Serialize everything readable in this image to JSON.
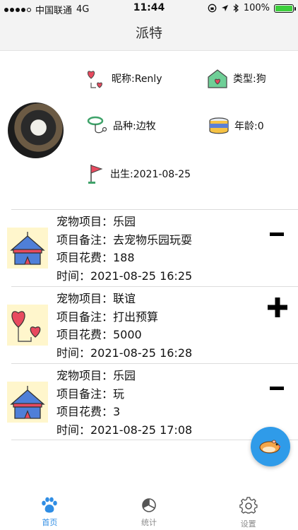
{
  "status_bar": {
    "carrier": "中国联通",
    "network": "4G",
    "time": "11:44",
    "battery": "100%",
    "battery_level": 1.0
  },
  "nav": {
    "title": "派特"
  },
  "profile": {
    "nickname": "昵称:Renly",
    "type": "类型:狗",
    "breed": "品种:边牧",
    "age": "年龄:0",
    "birth": "出生:2021-08-25"
  },
  "records": [
    {
      "project": "宠物项目：乐园",
      "note": "项目备注：去宠物乐园玩耍",
      "cost": "项目花费：188",
      "time": "时间：2021-08-25 16:25",
      "sign": "minus",
      "icon": "tent-icon"
    },
    {
      "project": "宠物项目：联谊",
      "note": "项目备注：打出预算",
      "cost": "项目花费：5000",
      "time": "时间：2021-08-25 16:28",
      "sign": "plus",
      "icon": "heart-balloons-icon"
    },
    {
      "project": "宠物项目：乐园",
      "note": "项目备注：玩",
      "cost": "项目花费：3",
      "time": "时间：2021-08-25 17:08",
      "sign": "minus",
      "icon": "tent-icon"
    }
  ],
  "tabs": [
    {
      "label": "首页",
      "icon": "paw-icon",
      "active": true
    },
    {
      "label": "统计",
      "icon": "pie-chart-icon",
      "active": false
    },
    {
      "label": "设置",
      "icon": "gear-icon",
      "active": false
    }
  ],
  "colors": {
    "accent": "#2f8de4",
    "fab": "#2f9be9",
    "battery": "#3ccf3c"
  }
}
